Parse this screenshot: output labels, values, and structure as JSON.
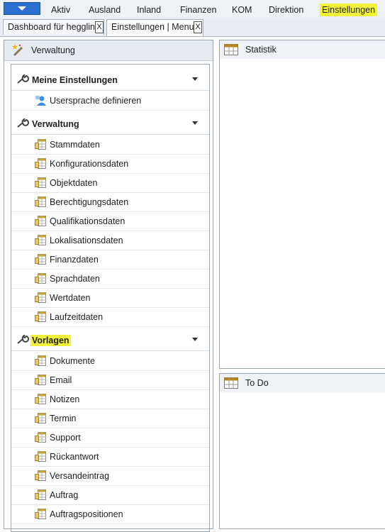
{
  "menubar": {
    "items": [
      "Aktiv",
      "Ausland",
      "Inland",
      "Finanzen",
      "KOM",
      "Direktion",
      "Einstellungen"
    ],
    "highlighted": "Einstellungen",
    "highlight_color": "#f2f23a",
    "app_button_color": "#2b6fd1"
  },
  "tabs": [
    {
      "label": "Dashboard für hegglin",
      "close": "X"
    },
    {
      "label": "Einstellungen | Menu",
      "close": "X"
    }
  ],
  "left_panel": {
    "title": "Verwaltung",
    "sections": [
      {
        "title": "Meine Einstellungen",
        "items": [
          "Usersprache definieren"
        ]
      },
      {
        "title": "Verwaltung",
        "items": [
          "Stammdaten",
          "Konfigurationsdaten",
          "Objektdaten",
          "Berechtigungsdaten",
          "Qualifikationsdaten",
          "Lokalisationsdaten",
          "Finanzdaten",
          "Sprachdaten",
          "Wertdaten",
          "Laufzeitdaten"
        ]
      },
      {
        "title": "Vorlagen",
        "highlighted": true,
        "items": [
          "Dokumente",
          "Email",
          "Notizen",
          "Termin",
          "Support",
          "Rückantwort",
          "Versandeintrag",
          "Auftrag",
          "Auftragspositionen"
        ]
      }
    ]
  },
  "right_panels": [
    {
      "title": "Statistik"
    },
    {
      "title": "To Do"
    }
  ]
}
